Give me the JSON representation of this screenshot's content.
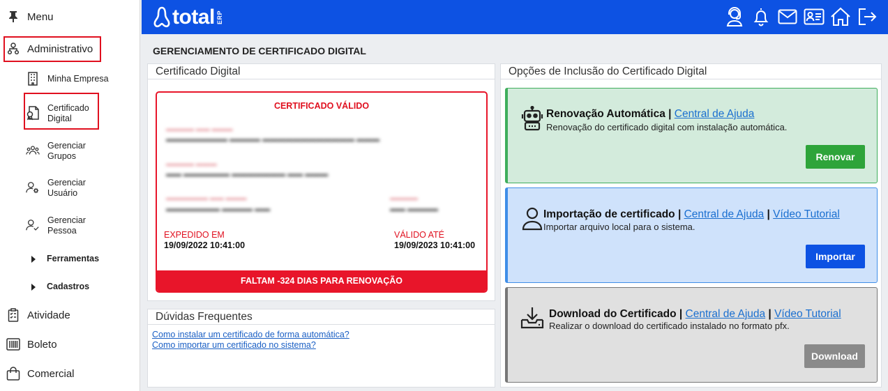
{
  "sidebar": {
    "menu": "Menu",
    "administrativo": "Administrativo",
    "minha_empresa": "Minha Empresa",
    "certificado_1": "Certificado",
    "certificado_2": "Digital",
    "gerenciar_grupos_1": "Gerenciar",
    "gerenciar_grupos_2": "Grupos",
    "gerenciar_usuario_1": "Gerenciar",
    "gerenciar_usuario_2": "Usuário",
    "gerenciar_pessoa_1": "Gerenciar",
    "gerenciar_pessoa_2": "Pessoa",
    "ferramentas": "Ferramentas",
    "cadastros": "Cadastros",
    "atividade": "Atividade",
    "boleto": "Boleto",
    "comercial": "Comercial"
  },
  "header": {
    "logo_text": "total",
    "logo_suffix": "ERP",
    "icons": [
      "support-icon",
      "bell-icon",
      "mail-icon",
      "id-card-icon",
      "home-icon",
      "logout-icon"
    ],
    "color": "#0d52e3"
  },
  "page": {
    "title": "GERENCIAMENTO DE CERTIFICADO DIGITAL"
  },
  "certificate_panel": {
    "heading": "Certificado Digital",
    "status": "CERTIFICADO VÁLIDO",
    "issued_label": "EXPEDIDO EM",
    "issued_value": "19/09/2022 10:41:00",
    "valid_label": "VÁLIDO ATÉ",
    "valid_value": "19/09/2023 10:41:00",
    "renewal_bar": "FALTAM -324 DIAS PARA RENOVAÇÃO"
  },
  "faq": {
    "heading": "Dúvidas Frequentes",
    "links": [
      "Como instalar um certificado de forma automática?",
      "Como importar um certificado no sistema?"
    ]
  },
  "options_panel": {
    "heading": "Opções de Inclusão do Certificado Digital",
    "renovacao": {
      "title": "Renovação Automática",
      "help": "Central de Ajuda",
      "desc": "Renovação do certificado digital com instalação automática.",
      "button": "Renovar"
    },
    "importacao": {
      "title": "Importação de certificado",
      "help": "Central de Ajuda",
      "video": "Vídeo Tutorial",
      "desc": "Importar arquivo local para o sistema.",
      "button": "Importar"
    },
    "download": {
      "title": "Download do Certificado",
      "help": "Central de Ajuda",
      "video": "Vídeo Tutorial",
      "desc": "Realizar o download do certificado instalado no formato pfx.",
      "button": "Download"
    }
  },
  "colors": {
    "accent_blue": "#0d52e3",
    "danger_red": "#e8152a",
    "success_green": "#2ea43a",
    "disabled_gray": "#8a8a8a"
  }
}
